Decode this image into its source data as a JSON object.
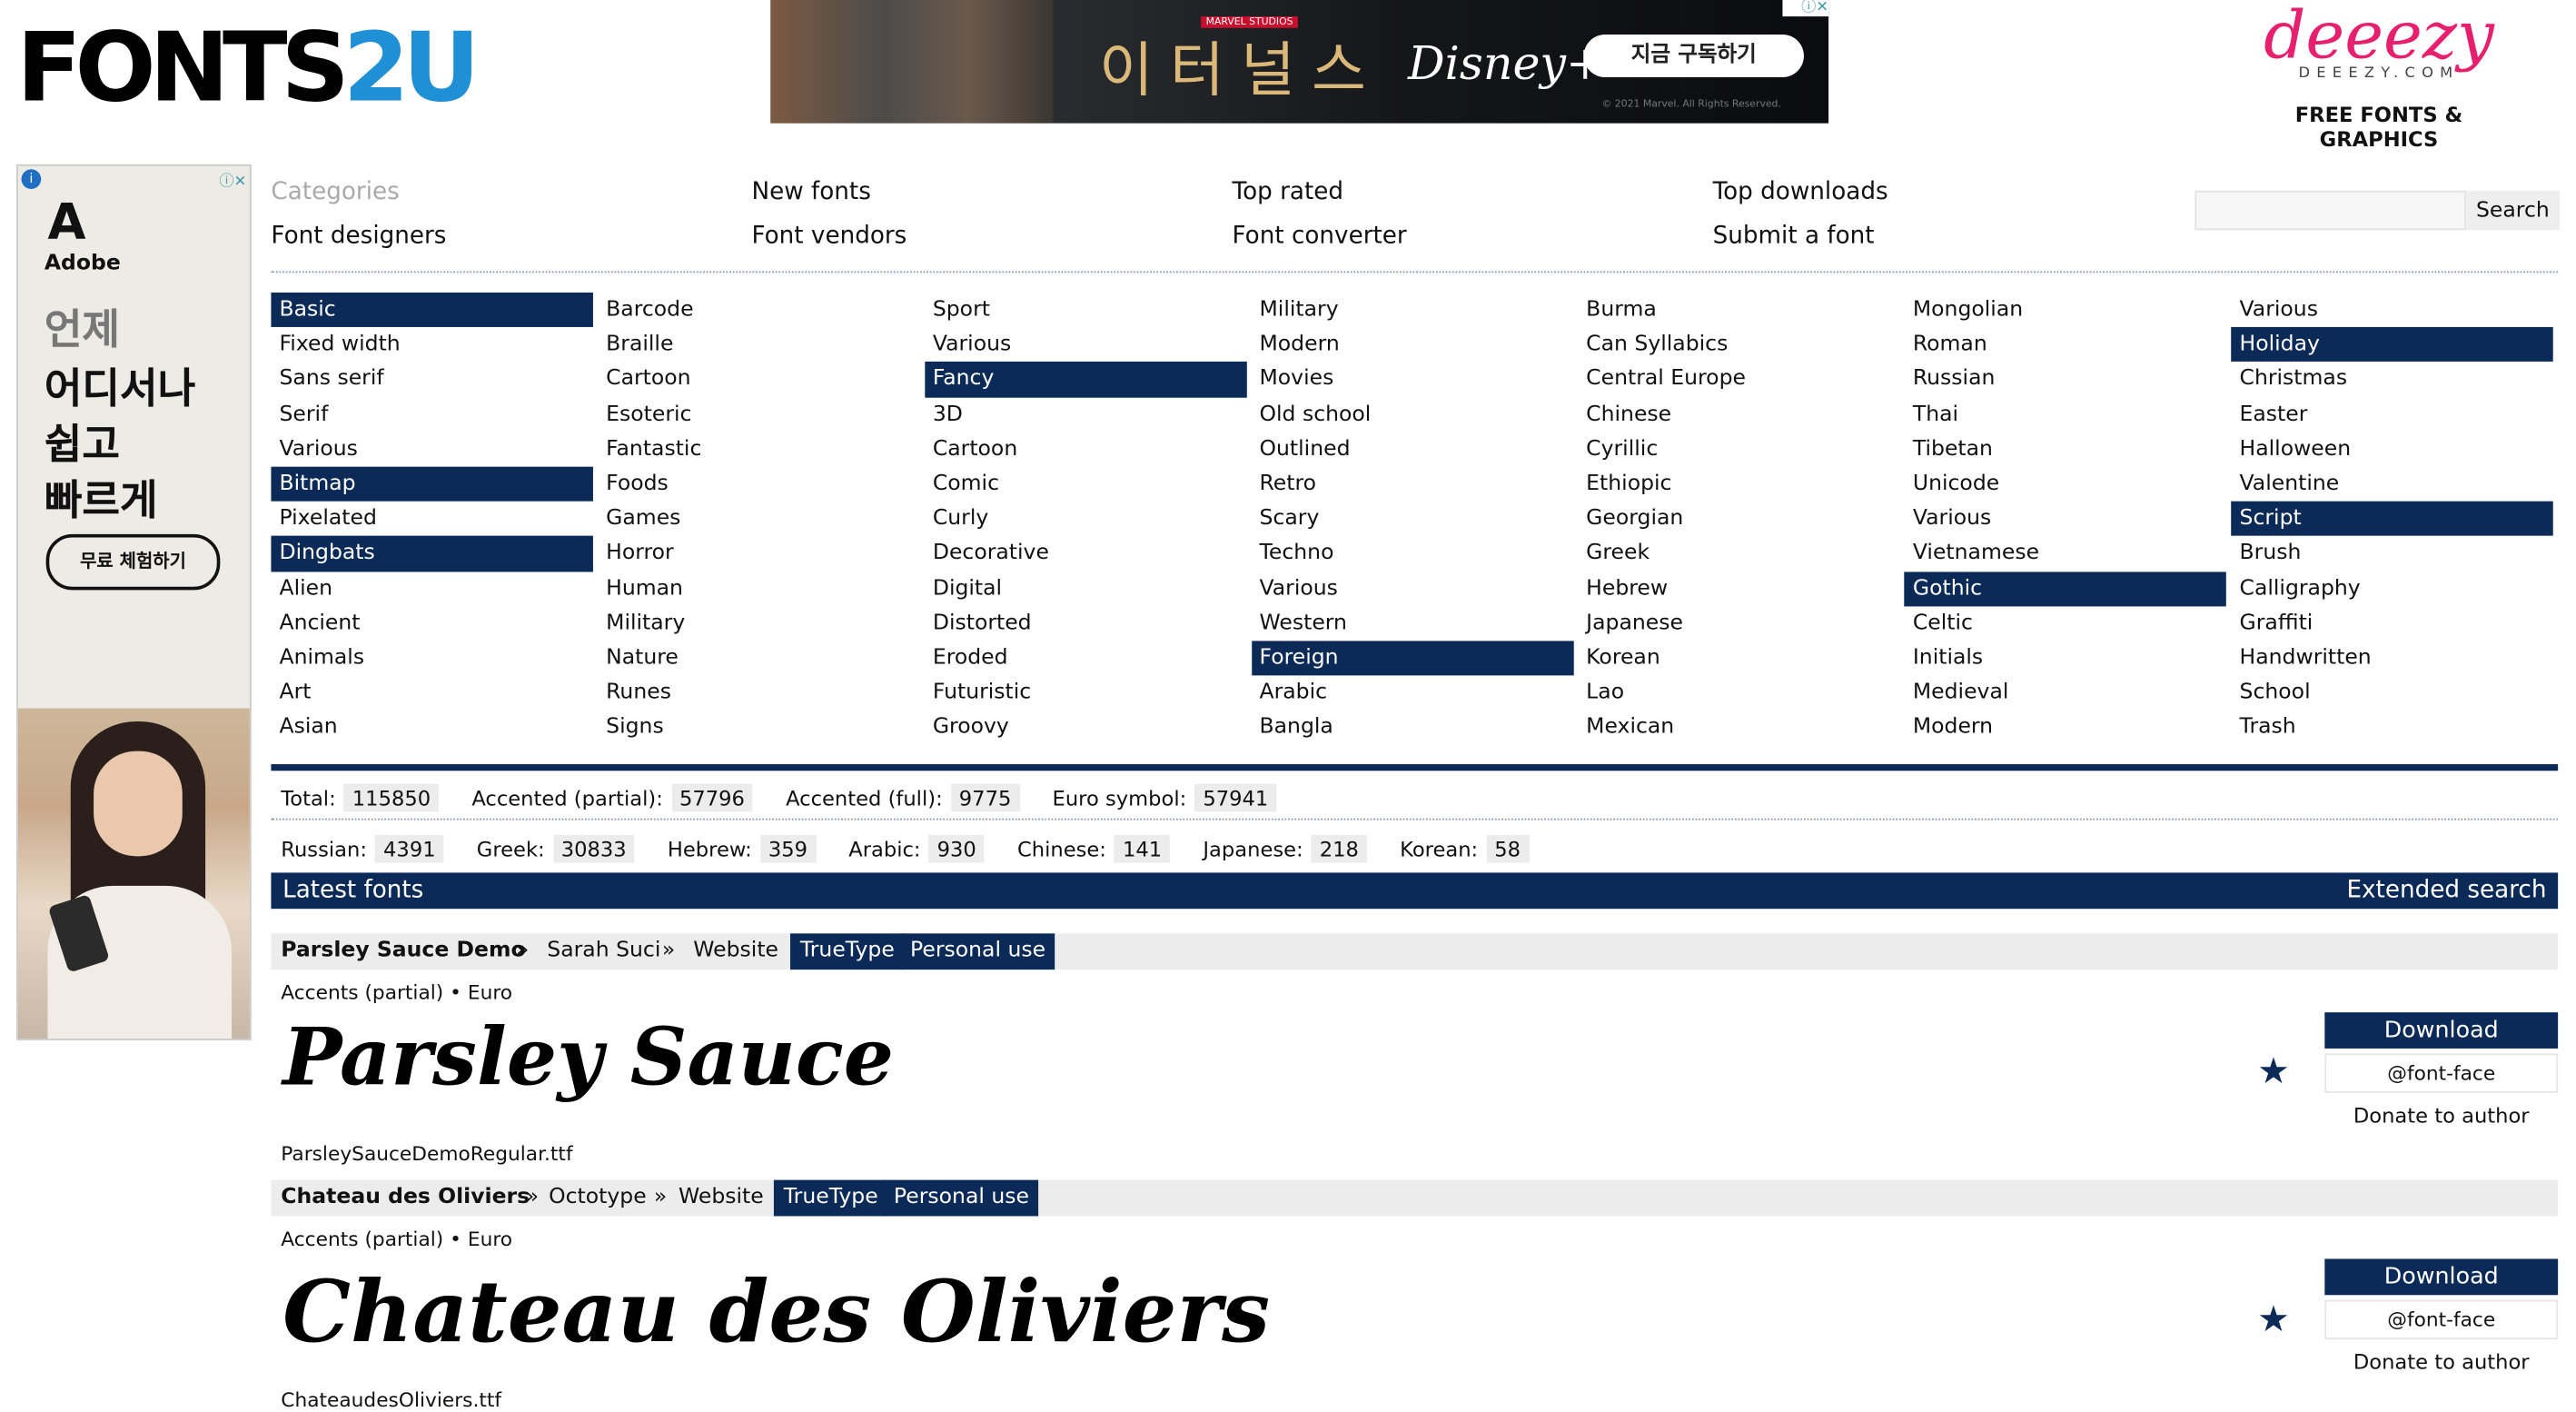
{
  "logo": {
    "fonts": "FONTS",
    "two": "2U"
  },
  "top_ad": {
    "title": "이터널스",
    "brand": "MARVEL STUDIOS",
    "streamer": "Disney+",
    "cta": "지금 구독하기",
    "fine": "© 2021 Marvel. All Rights Reserved."
  },
  "deeezy": {
    "name": "deeezy",
    "dotcom": "DEEEZY.COM",
    "tagline": "FREE FONTS & GRAPHICS"
  },
  "side_ad": {
    "brand": "Adobe",
    "line1": "언제",
    "line2": "어디서나",
    "line3": "쉽고",
    "line4": "빠르게",
    "cta": "무료 체험하기"
  },
  "nav": {
    "row1": [
      "Categories",
      "New fonts",
      "Top rated",
      "Top downloads"
    ],
    "row2": [
      "Font designers",
      "Font vendors",
      "Font converter",
      "Submit a font"
    ]
  },
  "search": {
    "button": "Search",
    "placeholder": ""
  },
  "categories": [
    [
      {
        "t": "Basic",
        "h": true
      },
      {
        "t": "Fixed width"
      },
      {
        "t": "Sans serif"
      },
      {
        "t": "Serif"
      },
      {
        "t": "Various"
      },
      {
        "t": "Bitmap",
        "h": true
      },
      {
        "t": "Pixelated"
      },
      {
        "t": "Dingbats",
        "h": true
      },
      {
        "t": "Alien"
      },
      {
        "t": "Ancient"
      },
      {
        "t": "Animals"
      },
      {
        "t": "Art"
      },
      {
        "t": "Asian"
      }
    ],
    [
      {
        "t": "Barcode"
      },
      {
        "t": "Braille"
      },
      {
        "t": "Cartoon"
      },
      {
        "t": "Esoteric"
      },
      {
        "t": "Fantastic"
      },
      {
        "t": "Foods"
      },
      {
        "t": "Games"
      },
      {
        "t": "Horror"
      },
      {
        "t": "Human"
      },
      {
        "t": "Military"
      },
      {
        "t": "Nature"
      },
      {
        "t": "Runes"
      },
      {
        "t": "Signs"
      }
    ],
    [
      {
        "t": "Sport"
      },
      {
        "t": "Various"
      },
      {
        "t": "Fancy",
        "h": true
      },
      {
        "t": "3D"
      },
      {
        "t": "Cartoon"
      },
      {
        "t": "Comic"
      },
      {
        "t": "Curly"
      },
      {
        "t": "Decorative"
      },
      {
        "t": "Digital"
      },
      {
        "t": "Distorted"
      },
      {
        "t": "Eroded"
      },
      {
        "t": "Futuristic"
      },
      {
        "t": "Groovy"
      }
    ],
    [
      {
        "t": "Military"
      },
      {
        "t": "Modern"
      },
      {
        "t": "Movies"
      },
      {
        "t": "Old school"
      },
      {
        "t": "Outlined"
      },
      {
        "t": "Retro"
      },
      {
        "t": "Scary"
      },
      {
        "t": "Techno"
      },
      {
        "t": "Various"
      },
      {
        "t": "Western"
      },
      {
        "t": "Foreign",
        "h": true
      },
      {
        "t": "Arabic"
      },
      {
        "t": "Bangla"
      }
    ],
    [
      {
        "t": "Burma"
      },
      {
        "t": "Can Syllabics"
      },
      {
        "t": "Central Europe"
      },
      {
        "t": "Chinese"
      },
      {
        "t": "Cyrillic"
      },
      {
        "t": "Ethiopic"
      },
      {
        "t": "Georgian"
      },
      {
        "t": "Greek"
      },
      {
        "t": "Hebrew"
      },
      {
        "t": "Japanese"
      },
      {
        "t": "Korean"
      },
      {
        "t": "Lao"
      },
      {
        "t": "Mexican"
      }
    ],
    [
      {
        "t": "Mongolian"
      },
      {
        "t": "Roman"
      },
      {
        "t": "Russian"
      },
      {
        "t": "Thai"
      },
      {
        "t": "Tibetan"
      },
      {
        "t": "Unicode"
      },
      {
        "t": "Various"
      },
      {
        "t": "Vietnamese"
      },
      {
        "t": "Gothic",
        "h": true
      },
      {
        "t": "Celtic"
      },
      {
        "t": "Initials"
      },
      {
        "t": "Medieval"
      },
      {
        "t": "Modern"
      }
    ],
    [
      {
        "t": "Various"
      },
      {
        "t": "Holiday",
        "h": true
      },
      {
        "t": "Christmas"
      },
      {
        "t": "Easter"
      },
      {
        "t": "Halloween"
      },
      {
        "t": "Valentine"
      },
      {
        "t": "Script",
        "h": true
      },
      {
        "t": "Brush"
      },
      {
        "t": "Calligraphy"
      },
      {
        "t": "Graffiti"
      },
      {
        "t": "Handwritten"
      },
      {
        "t": "School"
      },
      {
        "t": "Trash"
      }
    ]
  ],
  "stats1": [
    {
      "label": "Total:",
      "value": "115850"
    },
    {
      "label": "Accented (partial):",
      "value": "57796"
    },
    {
      "label": "Accented (full):",
      "value": "9775"
    },
    {
      "label": "Euro symbol:",
      "value": "57941"
    }
  ],
  "stats2": [
    {
      "label": "Russian:",
      "value": "4391"
    },
    {
      "label": "Greek:",
      "value": "30833"
    },
    {
      "label": "Hebrew:",
      "value": "359"
    },
    {
      "label": "Arabic:",
      "value": "930"
    },
    {
      "label": "Chinese:",
      "value": "141"
    },
    {
      "label": "Japanese:",
      "value": "218"
    },
    {
      "label": "Korean:",
      "value": "58"
    }
  ],
  "latest": {
    "title": "Latest fonts",
    "extended": "Extended search"
  },
  "fonts": [
    {
      "name": "Parsley Sauce Demo",
      "author": "Sarah Suci",
      "site": "Website",
      "type": "TrueType",
      "license": "Personal use",
      "meta": "Accents (partial) • Euro",
      "specimen": "Parsley Sauce",
      "file": "ParsleySauceDemoRegular.ttf"
    },
    {
      "name": "Chateau des Oliviers",
      "author": "Octotype",
      "site": "Website",
      "type": "TrueType",
      "license": "Personal use",
      "meta": "Accents (partial) • Euro",
      "specimen": "Chateau des Oliviers",
      "file": "ChateaudesOliviers.ttf"
    }
  ],
  "actions": {
    "download": "Download",
    "fontface": "@font-face",
    "donate": "Donate to author",
    "star": "★"
  }
}
